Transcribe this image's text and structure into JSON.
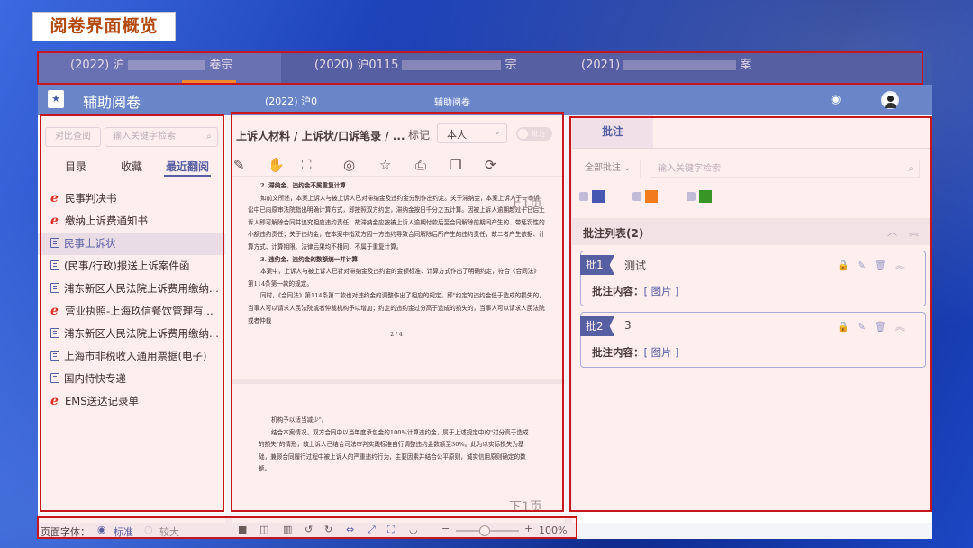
{
  "slide_title": "阅卷界面概览",
  "doc_tabs": [
    {
      "prefix": "(2022) 沪",
      "suffix": "卷宗"
    },
    {
      "prefix": "(2020) 沪0115",
      "suffix": "宗"
    },
    {
      "prefix": "(2021)",
      "suffix": "案"
    }
  ],
  "header": {
    "title": "辅助阅卷",
    "doc_title": "(2022) 沪0",
    "mode": "辅助阅卷",
    "logo_icon": "star-document-icon"
  },
  "left_panel": {
    "compare_button": "对比查阅",
    "search_placeholder": "输入关键字检索",
    "tabs": [
      "目录",
      "收藏",
      "最近翻阅"
    ],
    "items": [
      {
        "icon": "ie",
        "label": "民事判决书"
      },
      {
        "icon": "ie",
        "label": "缴纳上诉费通知书"
      },
      {
        "icon": "doc",
        "label": "民事上诉状"
      },
      {
        "icon": "doc",
        "label": "(民事/行政)报送上诉案件函"
      },
      {
        "icon": "doc",
        "label": "浦东新区人民法院上诉费用缴纳..."
      },
      {
        "icon": "ie",
        "label": "营业执照-上海玖信餐饮管理有..."
      },
      {
        "icon": "doc",
        "label": "浦东新区人民法院上诉费用缴纳..."
      },
      {
        "icon": "doc",
        "label": "上海市非税收入通用票据(电子)"
      },
      {
        "icon": "doc",
        "label": "国内特快专递"
      },
      {
        "icon": "ie",
        "label": "EMS送达记录单"
      }
    ],
    "selected_index": 2
  },
  "center_panel": {
    "breadcrumb": "上诉人材料 / 上诉状/口诉笔录 / ...",
    "mark_label": "标记",
    "mark_select": "本人",
    "toggle_label": "批注",
    "prev_page": "上1页",
    "next_page": "下1页",
    "page1_lines": [
      {
        "cls": "h",
        "text": "2. 滞纳金、违约金不属重复计算"
      },
      {
        "cls": "",
        "text": "如前文所述，本案上诉人与被上诉人已对滞纳金及违约金分别作出约定。关于滞纳金，本案上诉人于一审诉讼中已向原审法院指出明确计算方式，即按照双方约定，滞纳金按日千分之五计算。因被上诉人逾期超过十日后上诉人即可解除合同并追究相应违约责任，故滞纳金应按被上诉人逾期付款后至合同解除前期间产生的、带惩罚性的小额违约责任；关于违约金，在本案中指双方因一方违约导致合同解除后所产生的违约责任，故二者产生依据、计算方式、计算期限、法律后果均不相同，不属于重复计算。"
      },
      {
        "cls": "h",
        "text": "3. 违约金、违约金的数额统一并计算"
      },
      {
        "cls": "",
        "text": "本案中，上诉人与被上诉人已针对滞纳金及违约金的金额标准、计算方式作出了明确约定，符合《合同法》第114条第一款的规定。"
      },
      {
        "cls": "",
        "text": "同时，《合同法》第114条第二款也对违约金的调整作出了相应的规定，即\"约定的违约金低于造成的损失的，当事人可以请求人民法院或者仲裁机构予以增加；约定的违约金过分高于造成的损失的，当事人可以请求人民法院或者仲裁"
      }
    ],
    "page1_number": "2 / 4",
    "page2_lines": [
      {
        "cls": "",
        "text": "机构予以适当减少\"。"
      },
      {
        "cls": "",
        "text": "结合本案情况，双方合同中以当年度承包金的100%计算违约金，属于上述规定中的\"过分高于造成的损失\"的情形，故上诉人已结合司法审判实践标准自行调整违约金数额至30%。此为以实际损失为基础，兼顾合同履行过程中被上诉人的严重违约行为，主要因素并结合公平原则，诚实信用原则确定的数额。"
      }
    ],
    "footer_percent": "100%"
  },
  "right_panel": {
    "tab": "批注",
    "filter": "全部批注",
    "search_placeholder": "输入关键字检索",
    "colors": [
      "#2a52b8",
      "#f07d0e",
      "#1a9a1a"
    ],
    "list_title": "批注列表(2)",
    "cards": [
      {
        "tag": "批1",
        "text": "测试",
        "body_label": "批注内容：",
        "body_value": "[ 图片 ]"
      },
      {
        "tag": "批2",
        "text": "3",
        "body_label": "批注内容：",
        "body_value": "[ 图片 ]"
      }
    ]
  },
  "footer": {
    "font_label": "页面字体：",
    "opt_standard": "标准",
    "opt_large": "较大"
  }
}
